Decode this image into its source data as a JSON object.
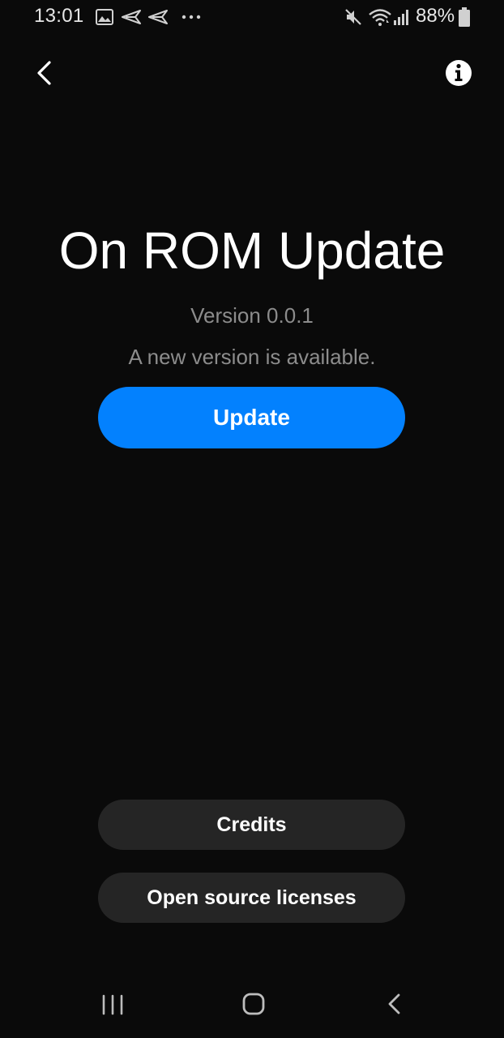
{
  "status_bar": {
    "time": "13:01",
    "battery_percent": "88%",
    "notification_icons": [
      "image-icon",
      "send-icon",
      "send-icon",
      "more-icon"
    ],
    "system_icons": [
      "mute-icon",
      "wifi-icon",
      "signal-icon",
      "battery-icon"
    ]
  },
  "header": {
    "back_icon": "chevron-left-icon",
    "info_icon": "info-icon"
  },
  "main": {
    "title": "On ROM Update",
    "version": "Version 0.0.1",
    "status": "A new version is available.",
    "update_label": "Update"
  },
  "footer": {
    "credits_label": "Credits",
    "licenses_label": "Open source licenses"
  },
  "nav_bar": {
    "icons": [
      "recents-icon",
      "home-icon",
      "back-icon"
    ]
  },
  "colors": {
    "background": "#0a0a0a",
    "accent": "#0381fe",
    "secondary_button": "#252525",
    "muted_text": "#8c8c8c"
  }
}
